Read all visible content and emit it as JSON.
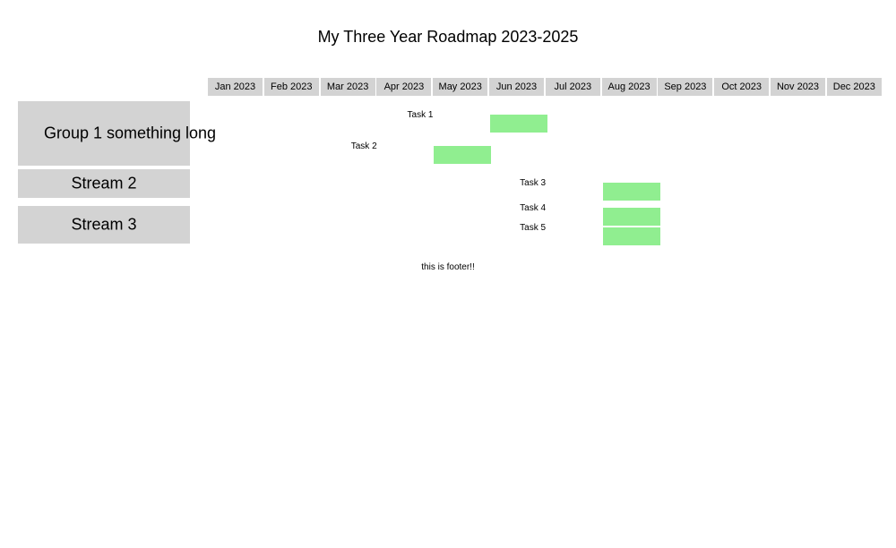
{
  "title": "My Three Year Roadmap 2023-2025",
  "months": [
    "Jan 2023",
    "Feb 2023",
    "Mar 2023",
    "Apr 2023",
    "May 2023",
    "Jun 2023",
    "Jul 2023",
    "Aug 2023",
    "Sep 2023",
    "Oct 2023",
    "Nov 2023",
    "Dec 2023"
  ],
  "groups": [
    {
      "label": "Group 1 something long"
    },
    {
      "label": "Stream 2"
    },
    {
      "label": "Stream 3"
    }
  ],
  "chart_data": {
    "type": "gantt",
    "title": "My Three Year Roadmap 2023-2025",
    "x_categories": [
      "Jan 2023",
      "Feb 2023",
      "Mar 2023",
      "Apr 2023",
      "May 2023",
      "Jun 2023",
      "Jul 2023",
      "Aug 2023",
      "Sep 2023",
      "Oct 2023",
      "Nov 2023",
      "Dec 2023"
    ],
    "tasks": [
      {
        "name": "Task 1",
        "group": "Group 1 something long",
        "start": "2023-06",
        "end": "2023-06"
      },
      {
        "name": "Task 2",
        "group": "Group 1 something long",
        "start": "2023-05",
        "end": "2023-05"
      },
      {
        "name": "Task 3",
        "group": "Stream 2",
        "start": "2023-08",
        "end": "2023-08"
      },
      {
        "name": "Task 4",
        "group": "Stream 3",
        "start": "2023-08",
        "end": "2023-08"
      },
      {
        "name": "Task 5",
        "group": "Stream 3",
        "start": "2023-08",
        "end": "2023-08"
      }
    ],
    "bar_color": "#90ee90",
    "header_color": "#d3d3d3"
  },
  "footer": "this is footer!!"
}
